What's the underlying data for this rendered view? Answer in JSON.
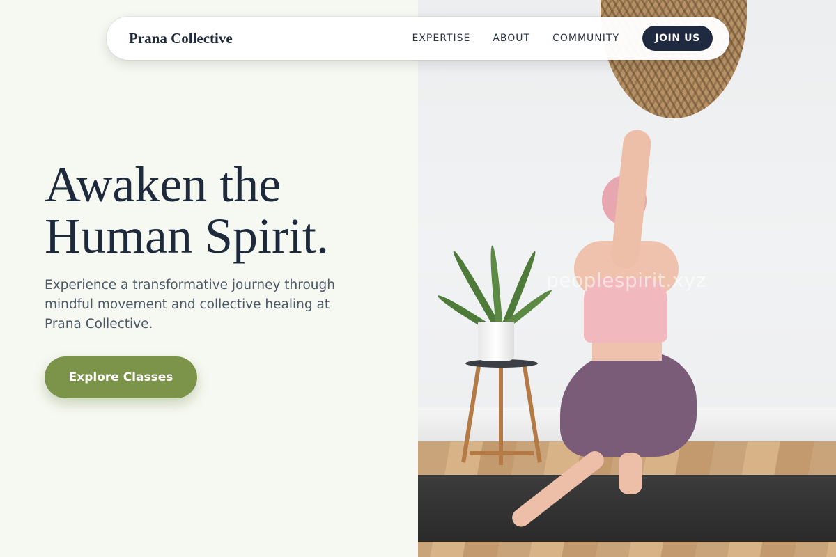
{
  "nav": {
    "brand": "Prana Collective",
    "links": [
      "EXPERTISE",
      "ABOUT",
      "COMMUNITY"
    ],
    "cta": "JOIN US"
  },
  "hero": {
    "title_line1": "Awaken the",
    "title_line2": "Human Spirit.",
    "description": "Experience a transformative journey through mindful movement and collective healing at Prana Collective.",
    "cta": "Explore Classes"
  },
  "photo": {
    "watermark": "peoplespirit.xyz"
  },
  "colors": {
    "accent_green": "#7b944a",
    "navy": "#1f2a40",
    "background": "#f6f9f1"
  }
}
